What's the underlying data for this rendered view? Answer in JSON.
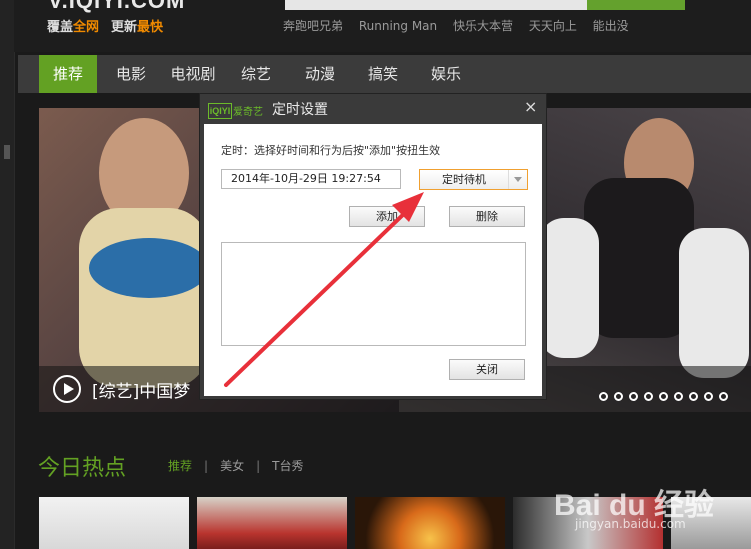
{
  "header": {
    "logo_text": "V.IQIYI.COM",
    "slogan_a_plain": "覆盖",
    "slogan_a_hl": "全网",
    "slogan_b_plain": "更新",
    "slogan_b_hl": "最快",
    "hot_words": [
      "奔跑吧兄弟",
      "Running Man",
      "快乐大本营",
      "天天向上",
      "能出没"
    ]
  },
  "nav": {
    "items": [
      "推荐",
      "电影",
      "电视剧",
      "综艺",
      "动漫",
      "搞笑",
      "娱乐"
    ],
    "active_index": 0
  },
  "banner": {
    "caption": "[综艺]中国梦",
    "dot_count": 9
  },
  "hot_section": {
    "title": "今日热点",
    "tabs": [
      "推荐",
      "美女",
      "T台秀"
    ],
    "separator": "|"
  },
  "dialog": {
    "logo_mark": "iQIYI",
    "logo_text": "爱奇艺",
    "title": "定时设置",
    "close_icon": "×",
    "instruction": "定时：选择好时间和行为后按\"添加\"按扭生效",
    "datetime_value": "2014年-10月-29日 19:27:54",
    "action_selected": "定时待机",
    "add_label": "添加",
    "delete_label": "删除",
    "close_label": "关闭"
  },
  "watermark": {
    "brand": "Bai du 经验",
    "url": "jingyan.baidu.com"
  },
  "colors": {
    "accent_green": "#63a123",
    "slogan_orange": "#f08a00",
    "arrow_red": "#e8303a"
  }
}
